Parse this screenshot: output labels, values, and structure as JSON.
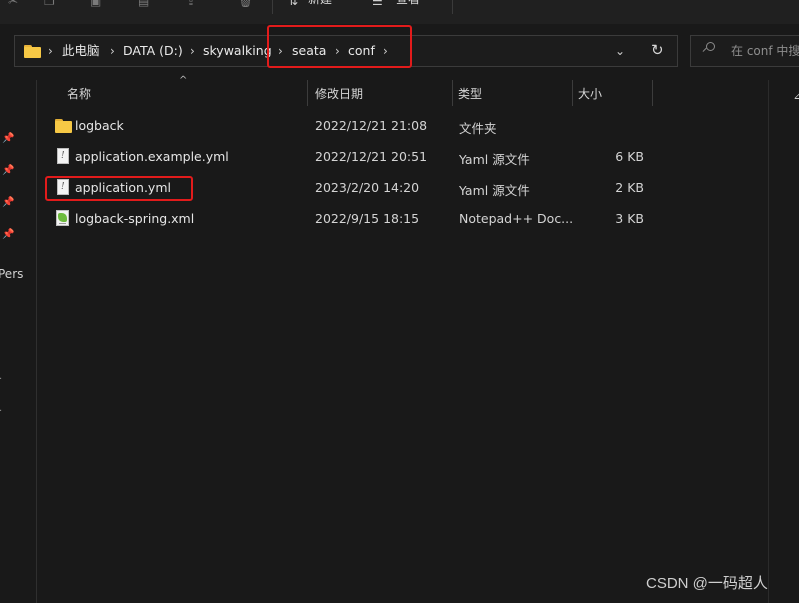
{
  "toolbar": {
    "items": [
      {
        "label": "新建",
        "icon": "sort-icon"
      },
      {
        "label": "查看",
        "icon": "view-icon"
      }
    ]
  },
  "address": {
    "crumbs": [
      "此电脑",
      "DATA (D:)",
      "skywalking",
      "seata",
      "conf"
    ],
    "dropdown_glyph": "⌄",
    "refresh_glyph": "↻"
  },
  "search": {
    "placeholder": "在 conf 中搜"
  },
  "nav": {
    "partial_label": "Pers"
  },
  "columns": {
    "name": "名称",
    "date": "修改日期",
    "type": "类型",
    "size": "大小"
  },
  "files": [
    {
      "name": "logback",
      "date": "2022/12/21 21:08",
      "type": "文件夹",
      "size": "",
      "icon": "folder-icon"
    },
    {
      "name": "application.example.yml",
      "date": "2022/12/21 20:51",
      "type": "Yaml 源文件",
      "size": "6 KB",
      "icon": "yaml-file-icon"
    },
    {
      "name": "application.yml",
      "date": "2023/2/20 14:20",
      "type": "Yaml 源文件",
      "size": "2 KB",
      "icon": "yaml-file-icon"
    },
    {
      "name": "logback-spring.xml",
      "date": "2022/9/15 18:15",
      "type": "Notepad++ Doc...",
      "size": "3 KB",
      "icon": "notepadpp-file-icon"
    }
  ],
  "highlight_color": "#e21b1b",
  "watermark": "CSDN @一码超人"
}
